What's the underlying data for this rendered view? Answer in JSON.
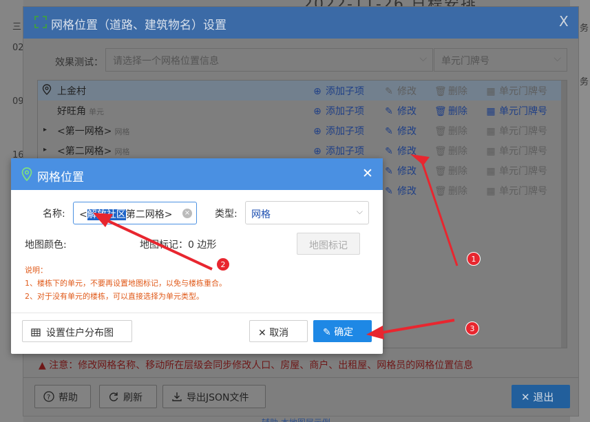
{
  "background": {
    "top_date": "2022-11-26 日程安排",
    "left_labels": [
      "三",
      "02",
      "09",
      "16"
    ],
    "right_labels": [
      "务",
      "务"
    ],
    "bottom_text": "辅助·本地图层示例"
  },
  "main_dialog": {
    "title": "网格位置（道路、建筑物名）设置",
    "close_glyph": "X",
    "test_label": "效果测试：",
    "test_placeholder": "请选择一个网格位置信息",
    "unit_placeholder": "单元门牌号",
    "tree_rows": [
      {
        "name": "上金村",
        "sub": "",
        "selected": true,
        "expander": "",
        "icon": "location-icon",
        "actions": {
          "add": "添加子项",
          "edit": "修改",
          "del": "删除",
          "unit": "单元门牌号"
        },
        "enabled": [
          true,
          false,
          false,
          false
        ]
      },
      {
        "name": "好旺角",
        "sub": "单元",
        "selected": false,
        "expander": "",
        "icon": "",
        "actions": {
          "add": "添加子项",
          "edit": "修改",
          "del": "删除",
          "unit": "单元门牌号"
        },
        "enabled": [
          true,
          true,
          true,
          true
        ]
      },
      {
        "name": "<第一网格>",
        "sub": "网格",
        "selected": false,
        "expander": "▸",
        "icon": "",
        "actions": {
          "add": "添加子项",
          "edit": "修改",
          "del": "删除",
          "unit": "单元门牌号"
        },
        "enabled": [
          true,
          true,
          false,
          false
        ]
      },
      {
        "name": "<第二网格>",
        "sub": "网格",
        "selected": false,
        "expander": "▸",
        "icon": "",
        "actions": {
          "add": "添加子项",
          "edit": "修改",
          "del": "删除",
          "unit": "单元门牌号"
        },
        "enabled": [
          true,
          true,
          false,
          false
        ]
      },
      {
        "name": "",
        "sub": "",
        "selected": false,
        "expander": "",
        "icon": "",
        "actions": {
          "add": "",
          "edit": "修改",
          "del": "删除",
          "unit": "单元门牌号"
        },
        "enabled": [
          false,
          true,
          false,
          false
        ]
      },
      {
        "name": "",
        "sub": "",
        "selected": false,
        "expander": "",
        "icon": "",
        "actions": {
          "add": "",
          "edit": "修改",
          "del": "删除",
          "unit": "单元门牌号"
        },
        "enabled": [
          false,
          true,
          false,
          false
        ]
      }
    ],
    "warning": "注意：修改网格名称、移动所在层级会同步修改人口、房屋、商户、出租屋、网格员的网格位置信息",
    "footer": {
      "help": "帮助",
      "refresh": "刷新",
      "export": "导出JSON文件",
      "exit": "退出"
    }
  },
  "grid_dialog": {
    "title": "网格位置",
    "close_glyph": "✕",
    "name_label": "名称:",
    "name_value_prefix": "<",
    "name_value_selected": "解放社区",
    "name_value_suffix": "第二网格>",
    "type_label": "类型:",
    "type_value": "网格",
    "map_color_label": "地图颜色:",
    "map_mark_info": "地图标记：0 边形",
    "map_mark_button": "地图标记",
    "notes": [
      "说明：",
      "1、楼栋下的单元，不要再设置地图标记，以免与楼栋重合。",
      "2、对于没有单元的楼栋，可以直接选择为单元类型。"
    ],
    "layout_button": "设置住户分布图",
    "cancel_button": "取消",
    "ok_button": "确定"
  },
  "callouts": [
    "1",
    "2",
    "3"
  ],
  "colors": {
    "arrow": "#e8262f",
    "primary": "#1e88e5",
    "header": "#4a90e2"
  }
}
